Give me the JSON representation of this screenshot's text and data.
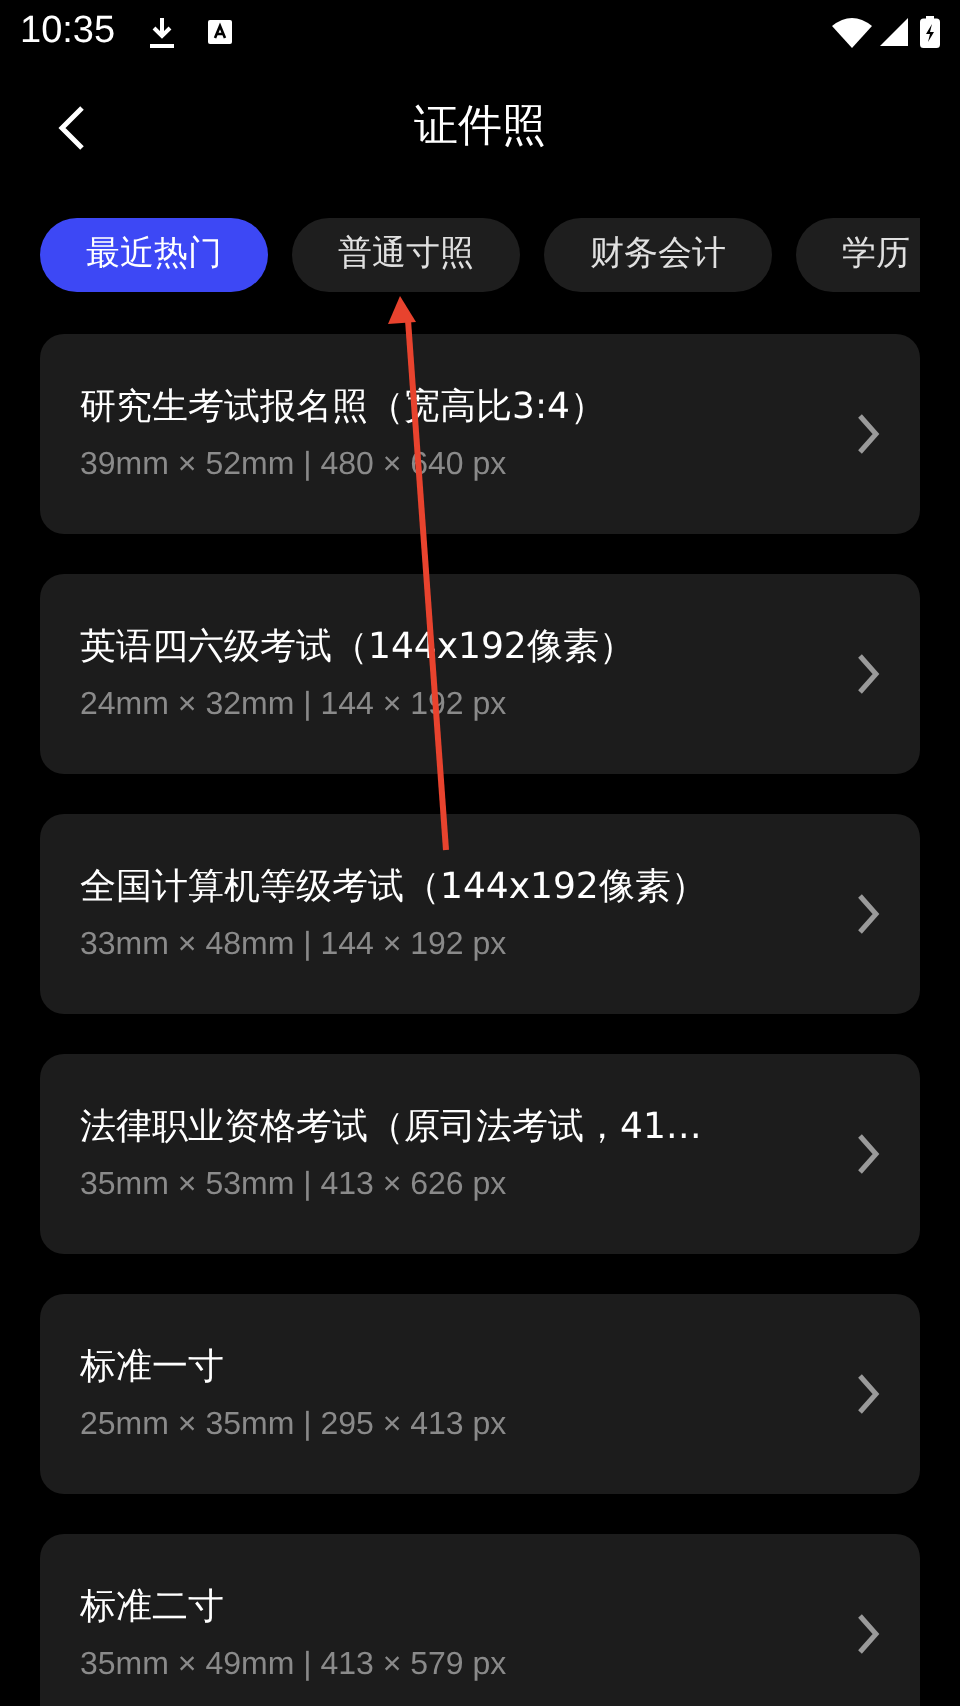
{
  "status_bar": {
    "time": "10:35"
  },
  "header": {
    "title": "证件照"
  },
  "tabs": [
    {
      "label": "最近热门",
      "selected": true
    },
    {
      "label": "普通寸照",
      "selected": false
    },
    {
      "label": "财务会计",
      "selected": false
    },
    {
      "label": "学历",
      "selected": false
    }
  ],
  "items": [
    {
      "title": "研究生考试报名照（宽高比3:4）",
      "size": "39mm × 52mm | 480 × 640 px"
    },
    {
      "title": "英语四六级考试（144x192像素）",
      "size": "24mm × 32mm | 144 × 192 px"
    },
    {
      "title": "全国计算机等级考试（144x192像素）",
      "size": "33mm × 48mm | 144 × 192 px"
    },
    {
      "title": "法律职业资格考试（原司法考试，41…",
      "size": "35mm × 53mm | 413 × 626 px"
    },
    {
      "title": "标准一寸",
      "size": "25mm × 35mm | 295 × 413 px"
    },
    {
      "title": "标准二寸",
      "size": "35mm × 49mm | 413 × 579 px"
    }
  ]
}
